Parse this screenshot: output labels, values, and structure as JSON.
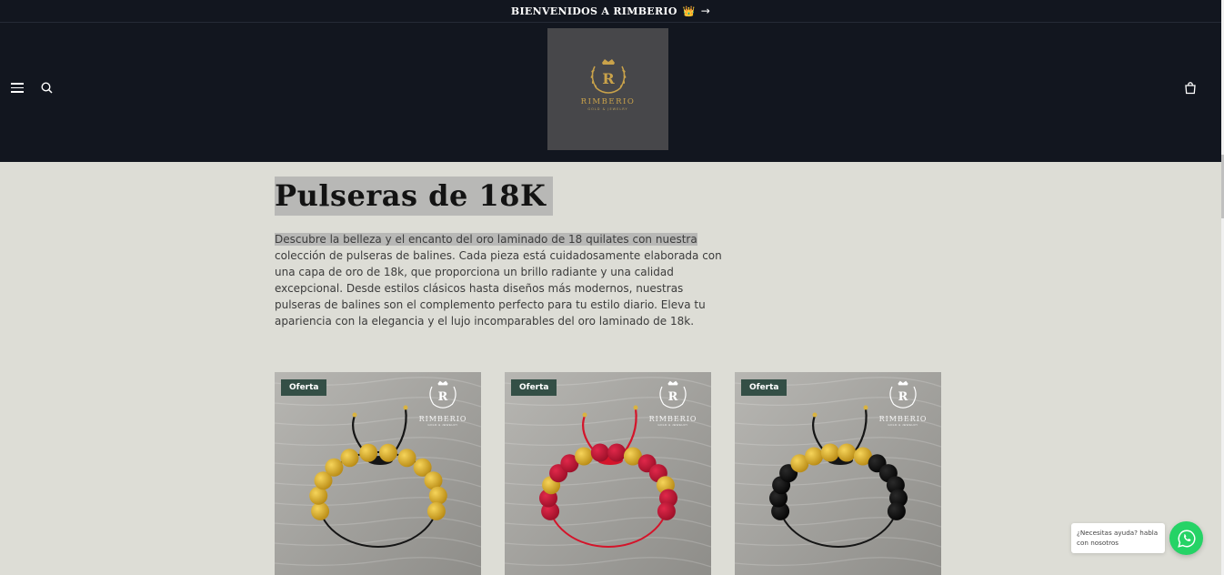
{
  "announcement": {
    "text": "BIENVENIDOS A RIMBERIO",
    "crown": "👑",
    "arrow": "→"
  },
  "header": {
    "logo": {
      "name": "RIMBERIO",
      "tagline": "GOLD & JEWELRY",
      "letter": "R"
    },
    "icons": [
      "menu-icon",
      "search-icon",
      "cart-icon"
    ]
  },
  "collection": {
    "title": "Pulseras de 18K",
    "description_highlight": "Descubre la belleza y el encanto del oro laminado de 18 quilates con nuestra",
    "description_rest": " colección de pulseras de balines. Cada pieza está cuidadosamente elaborada con una capa de oro de 18k, que proporciona un brillo radiante y una calidad excepcional. Desde estilos clásicos hasta diseños más modernos, nuestras pulseras de balines son el complemento perfecto para tu estilo diario. Eleva tu apariencia con la elegancia y el lujo incomparables del oro laminado de 18k."
  },
  "products": [
    {
      "badge": "Oferta",
      "watermark": "RIMBERIO",
      "watermark_sub": "GOLD & JEWELRY",
      "cord": "#151515",
      "beads": [
        "gold",
        "gold",
        "gold",
        "gold",
        "gold",
        "gold",
        "gold",
        "gold",
        "gold",
        "gold",
        "gold",
        "gold"
      ]
    },
    {
      "badge": "Oferta",
      "watermark": "RIMBERIO",
      "watermark_sub": "GOLD & JEWELRY",
      "cord": "#d4142a",
      "beads": [
        "red",
        "red",
        "gold",
        "red",
        "red",
        "gold",
        "red",
        "red",
        "gold",
        "red",
        "red",
        "gold",
        "red",
        "red"
      ]
    },
    {
      "badge": "Oferta",
      "watermark": "RIMBERIO",
      "watermark_sub": "GOLD & JEWELRY",
      "cord": "#151515",
      "beads": [
        "black",
        "black",
        "black",
        "black",
        "gold",
        "gold",
        "gold",
        "gold",
        "gold",
        "black",
        "black",
        "black",
        "black",
        "black"
      ]
    }
  ],
  "chat": {
    "text": "¿Necesitas ayuda? habla con nosotros"
  },
  "colors": {
    "header_bg": "#12161f",
    "page_bg": "#ddddd6",
    "badge_bg": "#344f46",
    "gold": "#c9a24a",
    "whatsapp": "#25d366"
  }
}
